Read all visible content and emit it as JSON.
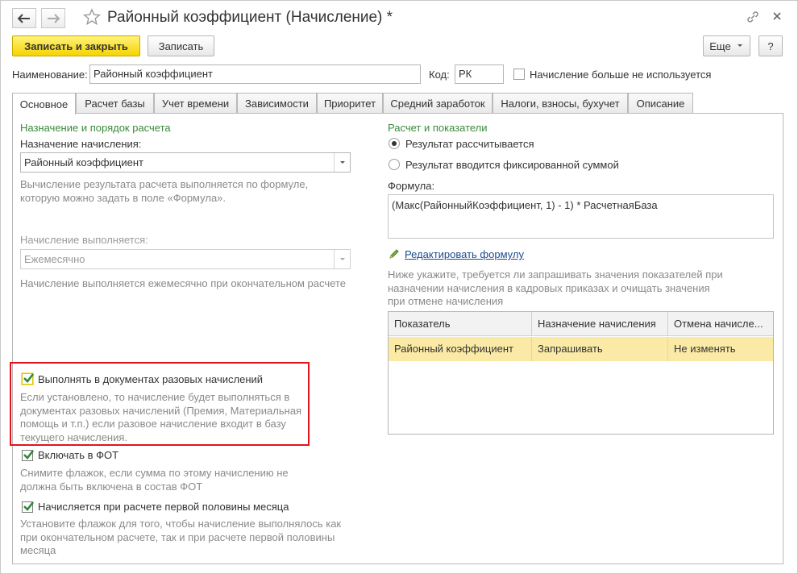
{
  "window": {
    "title": "Районный коэффициент (Начисление) *"
  },
  "toolbar": {
    "save_close_label": "Записать и закрыть",
    "save_label": "Записать",
    "more_label": "Еще",
    "help_label": "?"
  },
  "header": {
    "name_label": "Наименование:",
    "name_value": "Районный коэффициент",
    "code_label": "Код:",
    "code_value": "РК",
    "unused_label": "Начисление больше не используется"
  },
  "tabs": [
    {
      "label": "Основное"
    },
    {
      "label": "Расчет базы"
    },
    {
      "label": "Учет времени"
    },
    {
      "label": "Зависимости"
    },
    {
      "label": "Приоритет"
    },
    {
      "label": "Средний заработок"
    },
    {
      "label": "Налоги, взносы, бухучет"
    },
    {
      "label": "Описание"
    }
  ],
  "left": {
    "group_title": "Назначение и порядок расчета",
    "purpose_label": "Назначение начисления:",
    "purpose_value": "Районный коэффициент",
    "purpose_hint": "Вычисление результата расчета выполняется по формуле, которую можно задать в поле «Формула».",
    "schedule_label": "Начисление выполняется:",
    "schedule_value": "Ежемесячно",
    "schedule_hint": "Начисление выполняется ежемесячно при окончательном расчете",
    "one_time_label": "Выполнять в документах разовых начислений",
    "one_time_hint": "Если установлено, то начисление будет выполняться в документах разовых начислений (Премия, Материальная помощь и т.п.) если разовое начисление входит в базу текущего начисления.",
    "fot_label": "Включать в ФОТ",
    "fot_hint": "Снимите флажок, если сумма по этому начислению не должна быть включена в состав ФОТ",
    "first_half_label": "Начисляется при расчете первой половины месяца",
    "first_half_hint": "Установите флажок для того, чтобы начисление выполнялось как при окончательном расчете, так и при расчете первой половины месяца"
  },
  "right": {
    "group_title": "Расчет и показатели",
    "radio_calculated": "Результат рассчитывается",
    "radio_fixed": "Результат вводится фиксированной суммой",
    "formula_label": "Формула:",
    "formula_value": "(Макс(РайонныйКоэффициент, 1) - 1) * РасчетнаяБаза",
    "edit_formula_link": "Редактировать формулу",
    "indicators_hint": "Ниже укажите, требуется ли запрашивать значения показателей при назначении начисления в кадровых приказах и очищать значения при отмене начисления",
    "table": {
      "columns": [
        "Показатель",
        "Назначение начисления",
        "Отмена начисле..."
      ],
      "rows": [
        [
          "Районный коэффициент",
          "Запрашивать",
          "Не изменять"
        ]
      ]
    }
  },
  "colors": {
    "accent_yellow": "#f5d400",
    "group_title_green": "#3a8a3a",
    "highlight_red": "#e0141e",
    "selected_row": "#fbeaa6"
  }
}
